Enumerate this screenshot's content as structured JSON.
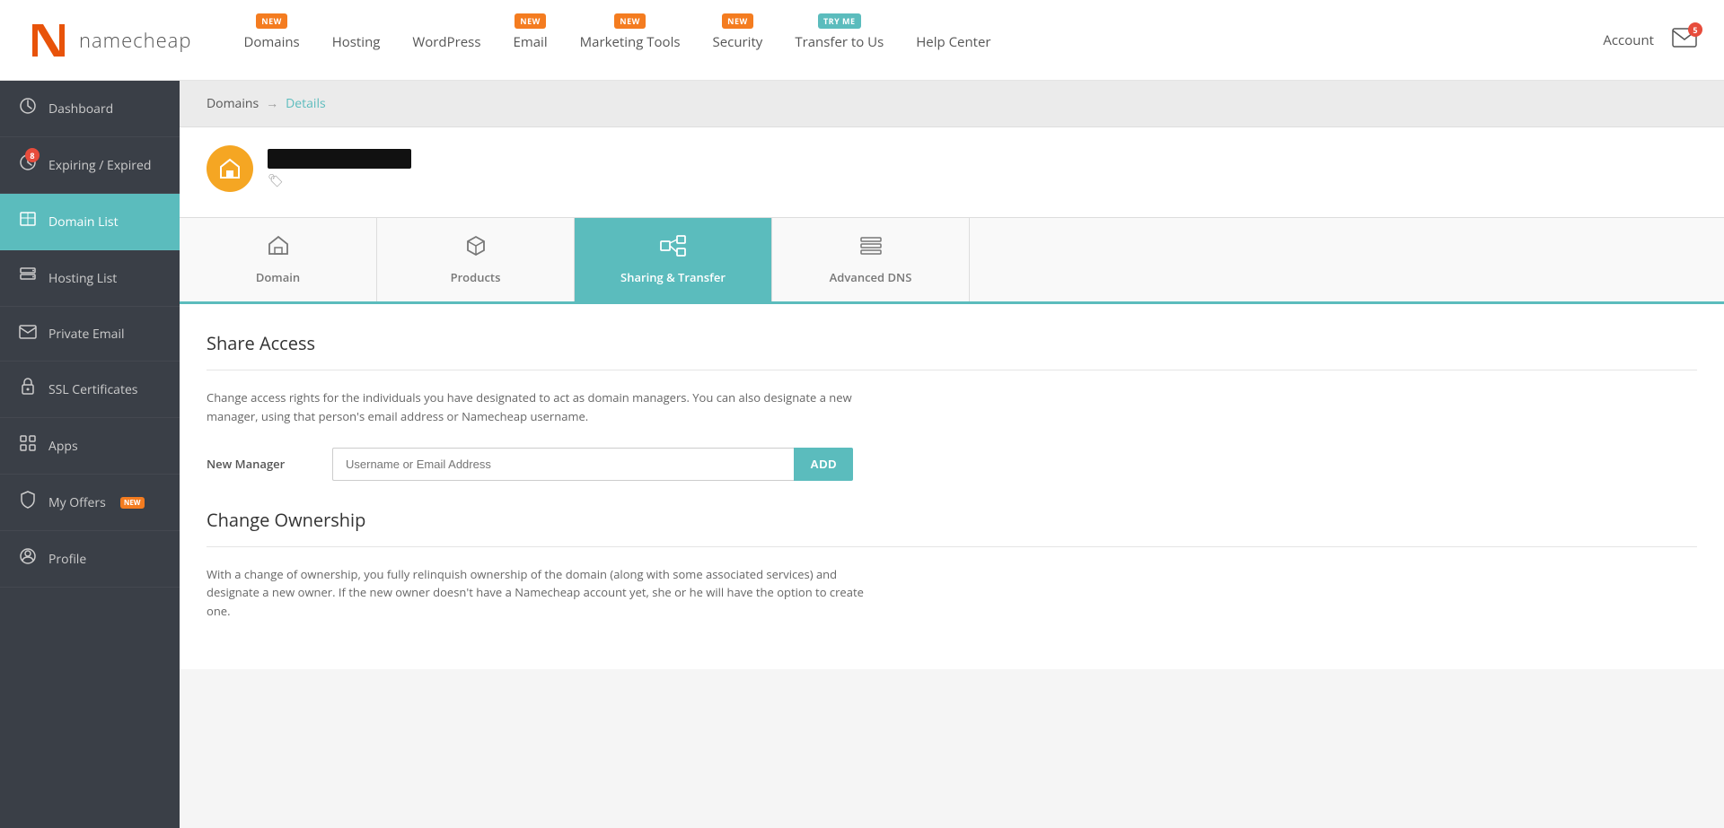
{
  "header": {
    "logo_text": "namecheap",
    "nav": [
      {
        "id": "domains",
        "label": "Domains",
        "badge": "NEW",
        "badge_type": "new"
      },
      {
        "id": "hosting",
        "label": "Hosting",
        "badge": null
      },
      {
        "id": "wordpress",
        "label": "WordPress",
        "badge": null
      },
      {
        "id": "email",
        "label": "Email",
        "badge": "NEW",
        "badge_type": "new"
      },
      {
        "id": "marketing",
        "label": "Marketing Tools",
        "badge": "NEW",
        "badge_type": "new"
      },
      {
        "id": "security",
        "label": "Security",
        "badge": "NEW",
        "badge_type": "new"
      },
      {
        "id": "transfer",
        "label": "Transfer to Us",
        "badge": "TRY ME",
        "badge_type": "tryme"
      },
      {
        "id": "helpcenter",
        "label": "Help Center",
        "badge": null
      }
    ],
    "account_label": "Account",
    "mail_count": "5"
  },
  "sidebar": {
    "items": [
      {
        "id": "dashboard",
        "label": "Dashboard",
        "icon": "⊙",
        "active": false,
        "badge": null
      },
      {
        "id": "expiring",
        "label": "Expiring / Expired",
        "icon": "⏰",
        "active": false,
        "badge": "8"
      },
      {
        "id": "domainlist",
        "label": "Domain List",
        "icon": "⌂",
        "active": true,
        "badge": null
      },
      {
        "id": "hostinglist",
        "label": "Hosting List",
        "icon": "▦",
        "active": false,
        "badge": null
      },
      {
        "id": "privateemail",
        "label": "Private Email",
        "icon": "✉",
        "active": false,
        "badge": null
      },
      {
        "id": "ssl",
        "label": "SSL Certificates",
        "icon": "🔒",
        "active": false,
        "badge": null
      },
      {
        "id": "apps",
        "label": "Apps",
        "icon": "❖",
        "active": false,
        "badge": null
      },
      {
        "id": "myoffers",
        "label": "My Offers",
        "icon": "🏷",
        "active": false,
        "badge": null,
        "new": true
      },
      {
        "id": "profile",
        "label": "Profile",
        "icon": "⚙",
        "active": false,
        "badge": null
      }
    ]
  },
  "breadcrumb": {
    "root": "Domains",
    "arrow": "→",
    "current": "Details"
  },
  "domain": {
    "avatar_icon": "🏠"
  },
  "tabs": [
    {
      "id": "domain",
      "label": "Domain",
      "icon": "⌂",
      "active": false
    },
    {
      "id": "products",
      "label": "Products",
      "icon": "📦",
      "active": false
    },
    {
      "id": "sharing",
      "label": "Sharing & Transfer",
      "icon": "⇢",
      "active": true
    },
    {
      "id": "advanceddns",
      "label": "Advanced DNS",
      "icon": "≡",
      "active": false
    }
  ],
  "share_access": {
    "title": "Share Access",
    "description": "Change access rights for the individuals you have designated to act as domain managers. You can also designate a new manager, using that person's email address or Namecheap username.",
    "new_manager_label": "New Manager",
    "input_placeholder": "Username or Email Address",
    "add_button_label": "ADD"
  },
  "change_ownership": {
    "title": "Change Ownership",
    "description": "With a change of ownership, you fully relinquish ownership of the domain (along with some associated services) and designate a new owner. If the new owner doesn't have a Namecheap account yet, she or he will have the option to create one."
  }
}
